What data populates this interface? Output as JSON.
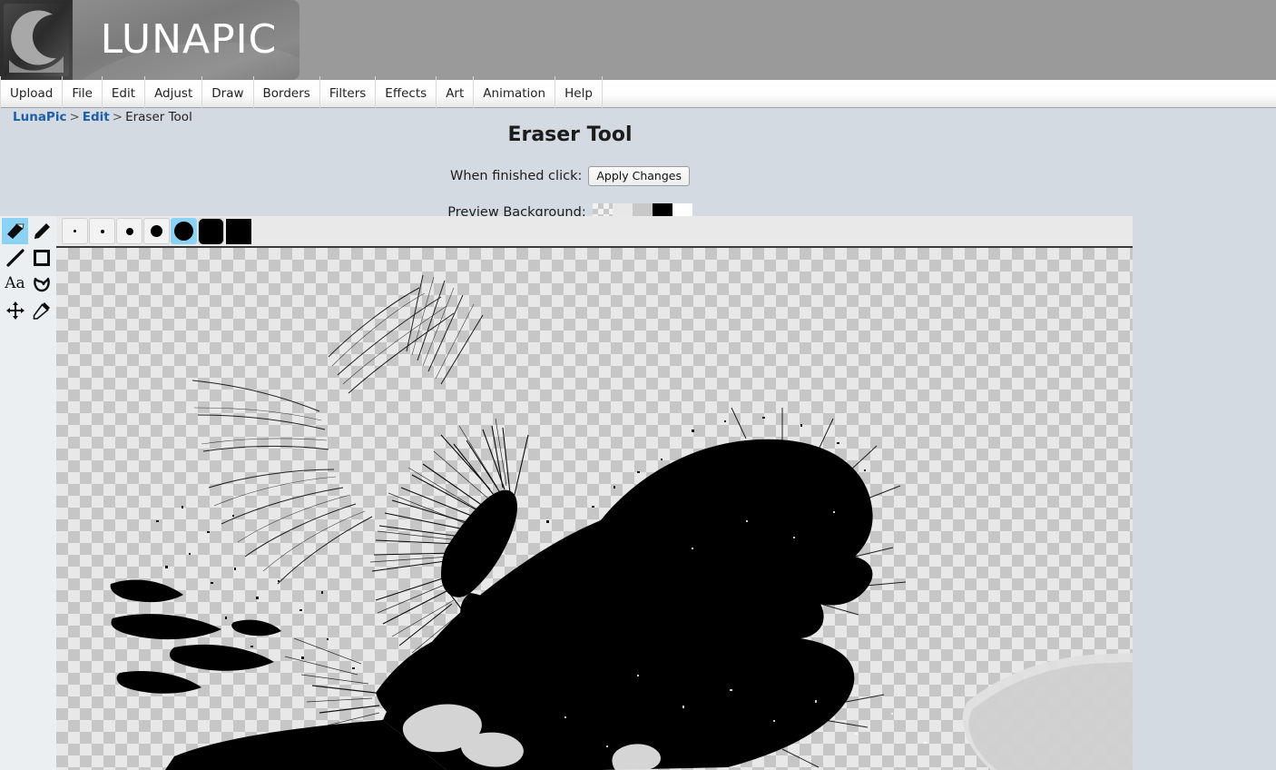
{
  "app": {
    "brand": "LUNAPIC",
    "logo_icon": "crescent-moon-icon"
  },
  "menubar": {
    "items": [
      {
        "label": "Upload"
      },
      {
        "label": "File"
      },
      {
        "label": "Edit"
      },
      {
        "label": "Adjust"
      },
      {
        "label": "Draw"
      },
      {
        "label": "Borders"
      },
      {
        "label": "Filters"
      },
      {
        "label": "Effects"
      },
      {
        "label": "Art"
      },
      {
        "label": "Animation"
      },
      {
        "label": "Help"
      }
    ]
  },
  "breadcrumb": {
    "root": "LunaPic",
    "sep1": ">",
    "parent": "Edit",
    "sep2": ">",
    "current": "Eraser Tool"
  },
  "page": {
    "title": "Eraser Tool",
    "apply_label_prefix": "When finished click:",
    "apply_button": "Apply Changes",
    "preview_bg_label": "Preview Background:"
  },
  "preview_backgrounds": [
    {
      "name": "transparent-checker",
      "color": "#f2f2f2"
    },
    {
      "name": "light-gray",
      "color": "#e8e8e8"
    },
    {
      "name": "gray",
      "color": "#c8c8c8"
    },
    {
      "name": "black",
      "color": "#000000"
    },
    {
      "name": "white",
      "color": "#ffffff"
    }
  ],
  "tools": [
    {
      "name": "eraser-tool",
      "icon": "eraser-icon",
      "selected": true
    },
    {
      "name": "pencil-tool",
      "icon": "pencil-icon",
      "selected": false
    },
    {
      "name": "line-tool",
      "icon": "line-icon",
      "selected": false
    },
    {
      "name": "rectangle-tool",
      "icon": "square-icon",
      "selected": false
    },
    {
      "name": "text-tool",
      "icon": "text-aa-icon",
      "label": "Aa",
      "selected": false
    },
    {
      "name": "shape-tool",
      "icon": "blob-shape-icon",
      "selected": false
    },
    {
      "name": "move-tool",
      "icon": "move-arrows-icon",
      "selected": false
    },
    {
      "name": "eyedropper-tool",
      "icon": "eyedropper-icon",
      "selected": false
    }
  ],
  "brush_sizes": [
    {
      "name": "brush-size-1",
      "radius": 1.5,
      "shape": "circle",
      "selected": false
    },
    {
      "name": "brush-size-2",
      "radius": 2.0,
      "shape": "circle",
      "selected": false
    },
    {
      "name": "brush-size-3",
      "radius": 4.0,
      "shape": "circle",
      "selected": false
    },
    {
      "name": "brush-size-4",
      "radius": 6.5,
      "shape": "circle",
      "selected": false
    },
    {
      "name": "brush-size-5",
      "radius": 10.5,
      "shape": "circle",
      "selected": true
    },
    {
      "name": "brush-size-6",
      "radius": 14.0,
      "shape": "circle",
      "selected": false
    },
    {
      "name": "brush-size-7",
      "radius": 14.0,
      "shape": "square",
      "selected": false
    }
  ],
  "canvas": {
    "name": "image-canvas",
    "content": "high-contrast black and white photo of a dog's head in profile on transparent checkerboard background",
    "accent": "#8ad3f5",
    "page_background": "#d4dae1"
  }
}
